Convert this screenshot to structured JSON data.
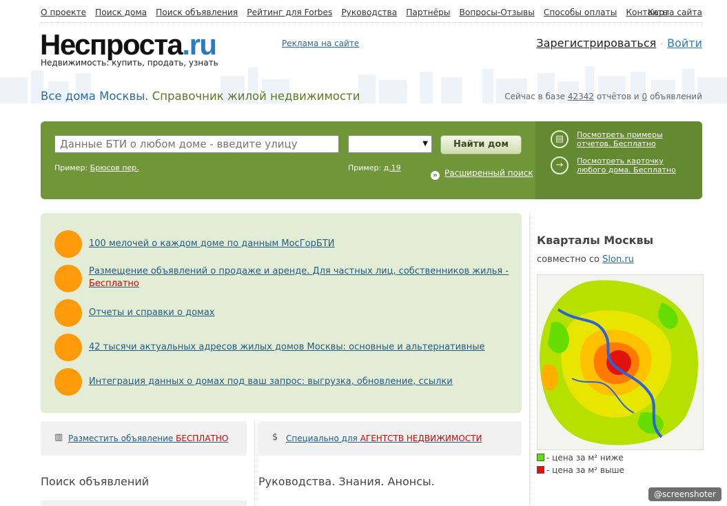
{
  "topnav": {
    "items": [
      "О проекте",
      "Поиск дома",
      "Поиск объявления",
      "Рейтинг для Forbes",
      "Руководства",
      "Партнёры",
      "Вопросы-Отзывы",
      "Способы оплаты",
      "Контакты"
    ],
    "site_map": "Карта сайта"
  },
  "header": {
    "logo_main": "Неспроста",
    "logo_tld": ".ru",
    "tagline": "Недвижимость: купить, продать, узнать",
    "ad_link": "Реклама на сайте",
    "register": "Зарегистрироваться",
    "separator": "·",
    "login": "Войти"
  },
  "headline": {
    "part1": "Все дома Москвы.",
    "part2": "Справочник жилой недвижимости",
    "counts_prefix": "Сейчас в базе",
    "reports_count": "42342",
    "counts_mid": "отчётов и",
    "ads_count": "0",
    "counts_suffix": "объявлений"
  },
  "search": {
    "placeholder": "Данные БТИ о любом доме - введите улицу",
    "button": "Найти дом",
    "example_label": "Пример:",
    "example_street": "Брюсов пер.",
    "example_house": "д.19",
    "advanced": "Расширенный поиск",
    "side": [
      {
        "line1": "Посмотреть примеры",
        "line2": "отчетов. Бесплатно"
      },
      {
        "line1": "Посмотреть карточку",
        "line2": "любого дома. Бесплатно"
      }
    ]
  },
  "features": [
    {
      "text": "100 мелочей о каждом доме по данным МосГорБТИ"
    },
    {
      "text": "Размещение объявлений о продаже и аренде. Для частных лиц, собственников жилья -",
      "text2": "Бесплатно"
    },
    {
      "text": "Отчеты и справки о домах"
    },
    {
      "text": "42 тысячи актуальных адресов жилых домов Москвы: основные и альтернативные"
    },
    {
      "text": "Интеграция данных о домах под ваш запрос: выгрузка, обновление, ссылки"
    }
  ],
  "actions": {
    "post_ad_prefix": "Разместить объявление",
    "post_ad_free": "БЕСПЛАТНО",
    "agencies_prefix": "Специально для",
    "agencies_red": "АГЕНТСТВ НЕДВИЖИМОСТИ"
  },
  "sections": {
    "ads_search": "Поиск объявлений",
    "guides": "Руководства. Знания. Анонсы."
  },
  "sidebar": {
    "title": "Кварталы Москвы",
    "sub_prefix": "совместно со",
    "sub_link": "Slon.ru",
    "legend_low": "- цена за м² ниже",
    "legend_high": "- цена за м² выше",
    "colors": {
      "low": "#66dd00",
      "high": "#e0120b"
    }
  },
  "watermark": "@screenshoter"
}
